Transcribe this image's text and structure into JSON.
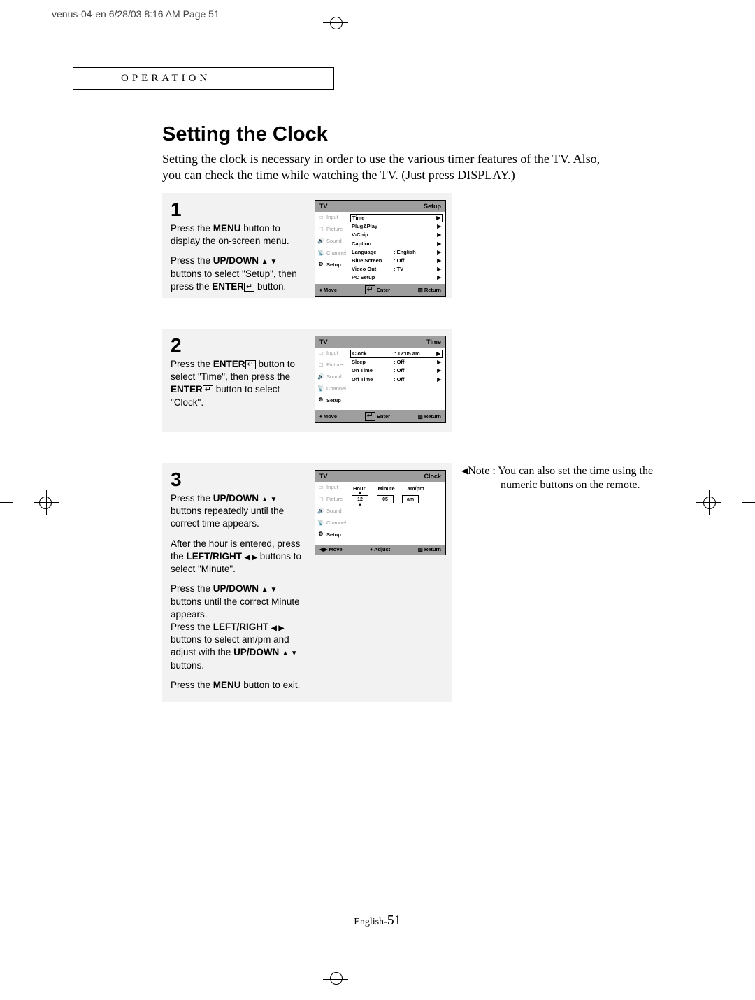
{
  "slug": "venus-04-en  6/28/03  8:16 AM  Page 51",
  "section_header": "OPERATION",
  "title": "Setting the Clock",
  "intro": "Setting the clock is  necessary in order to use the various timer features of the TV. Also, you can check the time while watching the TV. (Just press DISPLAY.)",
  "steps": {
    "s1": {
      "num": "1",
      "p1a": "Press the ",
      "p1b": "MENU",
      "p1c": " button to display the on-screen menu.",
      "p2a": "Press the ",
      "p2b": "UP/DOWN",
      "p2c": " buttons to select \"Setup\", then press the ",
      "p2d": "ENTER",
      "p2e": " button."
    },
    "s2": {
      "num": "2",
      "p1a": "Press the ",
      "p1b": "ENTER",
      "p1c": " button to select \"Time\", then press the ",
      "p1d": "ENTER",
      "p1e": " button to select \"Clock\"."
    },
    "s3": {
      "num": "3",
      "p1a": "Press the ",
      "p1b": "UP/DOWN",
      "p1c": " buttons repeatedly until the correct time appears.",
      "p2a": "After the hour is entered, press the ",
      "p2b": "LEFT/RIGHT",
      "p2c": " buttons to select \"Minute\".",
      "p3a": "Press the ",
      "p3b": "UP/DOWN",
      "p3c": " buttons until the correct Minute appears.",
      "p3d": "Press the ",
      "p3e": "LEFT/RIGHT",
      "p3f": " buttons to select am/pm and adjust with the ",
      "p3g": "UP/DOWN",
      "p3h": " buttons.",
      "p4a": "Press the ",
      "p4b": "MENU",
      "p4c": " button to exit."
    }
  },
  "osd_side": {
    "input": "Input",
    "picture": "Picture",
    "sound": "Sound",
    "channel": "Channel",
    "setup": "Setup"
  },
  "osd1": {
    "tv": "TV",
    "menu": "Setup",
    "rows": {
      "time": "Time",
      "plugplay": "Plug&Play",
      "vchip": "V-Chip",
      "caption": "Caption",
      "language": "Language",
      "language_v": ":   English",
      "bluescreen": "Blue Screen",
      "bluescreen_v": ":   Off",
      "videoout": "Video Out",
      "videoout_v": ":   TV",
      "pcsetup": "PC Setup"
    },
    "ftr": {
      "move": "Move",
      "enter": "Enter",
      "ret": "Return"
    }
  },
  "osd2": {
    "tv": "TV",
    "menu": "Time",
    "rows": {
      "clock": "Clock",
      "clock_v": ":   12:05 am",
      "sleep": "Sleep",
      "sleep_v": ":   Off",
      "ontime": "On Time",
      "ontime_v": ":   Off",
      "offtime": "Off Time",
      "offtime_v": ":   Off"
    },
    "ftr": {
      "move": "Move",
      "enter": "Enter",
      "ret": "Return"
    }
  },
  "osd3": {
    "tv": "TV",
    "menu": "Clock",
    "cols": {
      "hour": "Hour",
      "minute": "Minute",
      "ampm": "am/pm"
    },
    "vals": {
      "hour": "12",
      "minute": "05",
      "ampm": "am"
    },
    "ftr": {
      "move": "Move",
      "adjust": "Adjust",
      "ret": "Return"
    }
  },
  "note": {
    "label": "Note :",
    "text": "You can also set the time using the numeric buttons on the remote."
  },
  "footer": {
    "lang": "English-",
    "page": "51"
  }
}
